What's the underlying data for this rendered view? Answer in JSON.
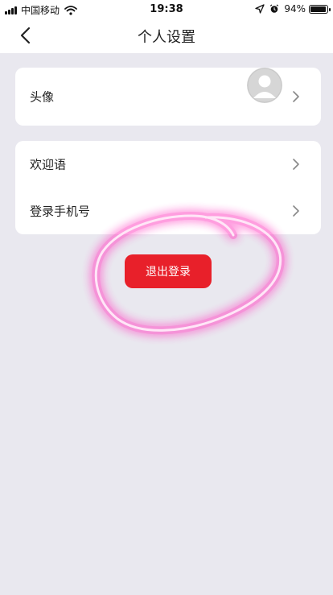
{
  "status_bar": {
    "carrier": "中国移动",
    "time": "19:38",
    "battery": "94%",
    "battery_level": 0.94
  },
  "nav": {
    "title": "个人设置"
  },
  "profile": {
    "avatar_label": "头像"
  },
  "settings_list": {
    "items": [
      {
        "label": "欢迎语"
      },
      {
        "label": "登录手机号"
      }
    ]
  },
  "actions": {
    "logout_label": "退出登录"
  },
  "colors": {
    "accent": "#e8202a",
    "background": "#e9e8ef",
    "annotation": "#ff4fc6"
  }
}
